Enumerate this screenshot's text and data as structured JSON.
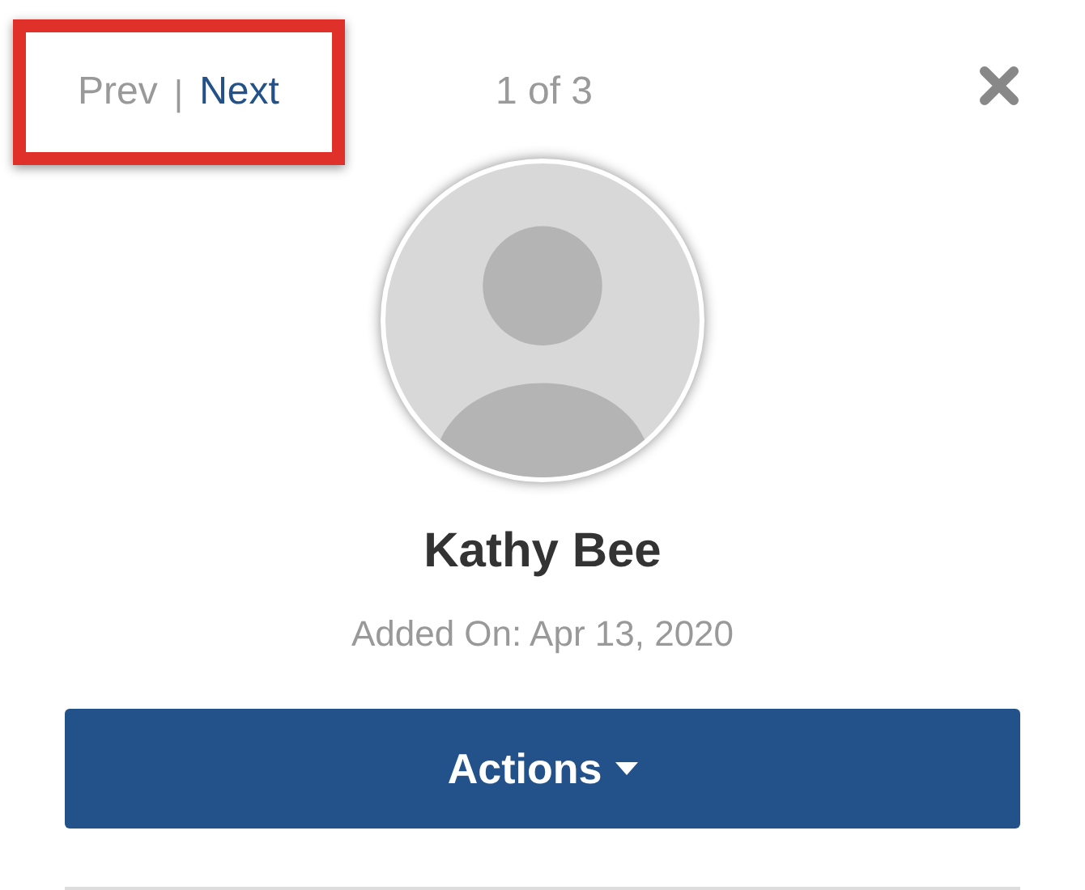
{
  "pager": {
    "highlighted": true,
    "links": [
      {
        "label": "Prev",
        "disabled": true
      },
      {
        "label": "Next",
        "disabled": false
      }
    ],
    "separator": "|",
    "position": "1 of 3"
  },
  "profile": {
    "name": "Kathy Bee",
    "added": "Added On: Apr 13, 2020"
  },
  "actions_button": {
    "label": "Actions"
  }
}
